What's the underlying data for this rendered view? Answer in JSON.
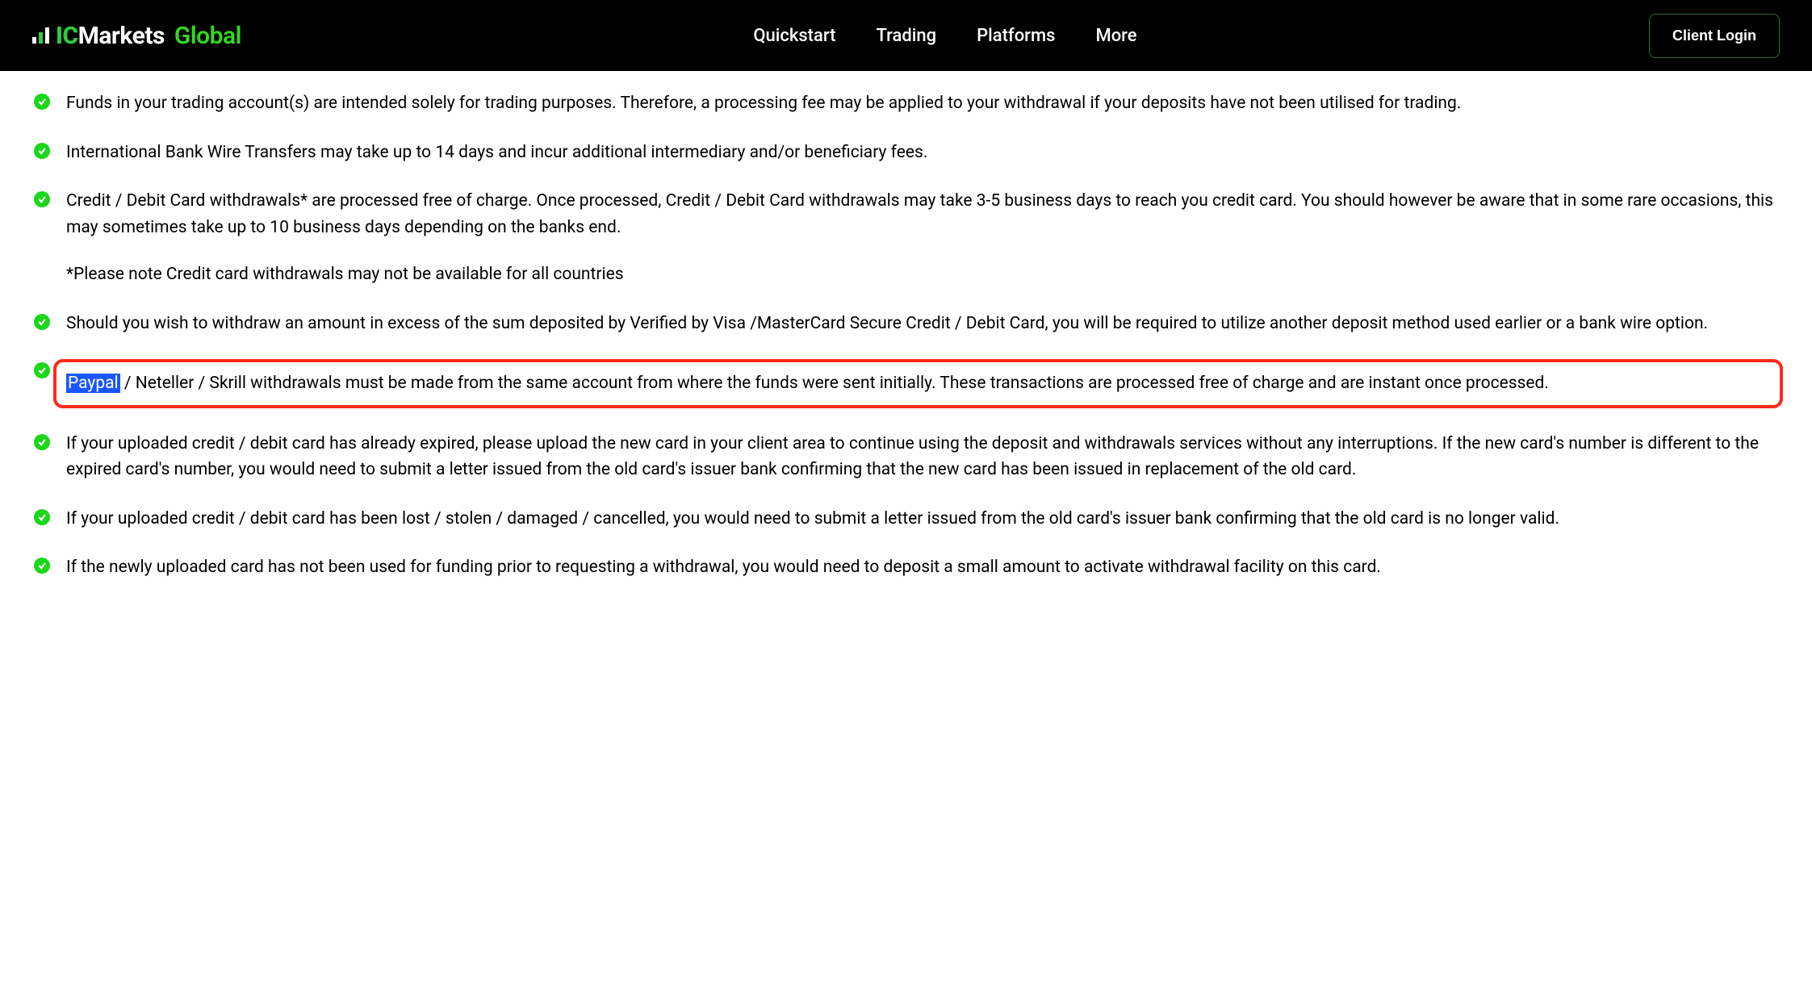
{
  "header": {
    "logo_ic": "IC",
    "logo_markets": "Markets",
    "logo_global": "Global",
    "nav": [
      "Quickstart",
      "Trading",
      "Platforms",
      "More"
    ],
    "login": "Client Login"
  },
  "points": [
    {
      "text": "Funds in your trading account(s) are intended solely for trading purposes. Therefore, a processing fee may be applied to your withdrawal if your deposits have not been utilised for trading."
    },
    {
      "text": "International Bank Wire Transfers may take up to 14 days and incur additional intermediary and/or beneficiary fees."
    },
    {
      "text": "Credit / Debit Card withdrawals* are processed free of charge. Once processed, Credit / Debit Card withdrawals may take 3-5 business days to reach you credit card. You should however be aware that in some rare occasions, this may sometimes take up to 10 business days depending on the banks end.",
      "note": "*Please note Credit card withdrawals may not be available for all countries"
    },
    {
      "text": "Should you wish to withdraw an amount in excess of the sum deposited by Verified by Visa /MasterCard Secure Credit / Debit Card, you will be required to utilize another deposit method used earlier or a bank wire option."
    },
    {
      "highlight": true,
      "selected": "Paypal",
      "rest": " / Neteller / Skrill withdrawals must be made from the same account from where the funds were sent initially. These transactions are processed free of charge and are instant once processed."
    },
    {
      "text": "If your uploaded credit / debit card has already expired, please upload the new card in your client area to continue using the deposit and withdrawals services without any interruptions. If the new card's number is different to the expired card's number, you would need to submit a letter issued from the old card's issuer bank confirming that the new card has been issued in replacement of the old card."
    },
    {
      "text": "If your uploaded credit / debit card has been lost / stolen / damaged / cancelled, you would need to submit a letter issued from the old card's issuer bank confirming that the old card is no longer valid."
    },
    {
      "text": "If the newly uploaded card has not been used for funding prior to requesting a withdrawal, you would need to deposit a small amount to activate withdrawal facility on this card."
    }
  ]
}
